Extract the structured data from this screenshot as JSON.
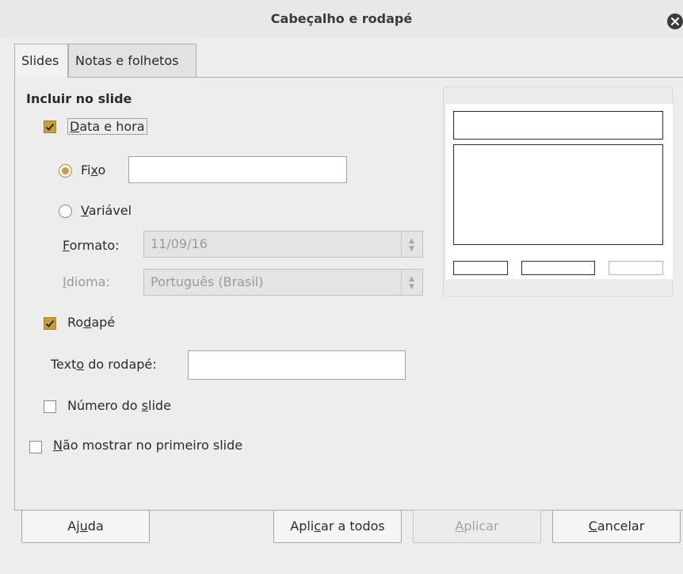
{
  "window": {
    "title": "Cabeçalho e rodapé"
  },
  "tabs": [
    {
      "label": "Slides"
    },
    {
      "label": "Notas e folhetos"
    }
  ],
  "include_section": {
    "title": "Incluir no slide"
  },
  "date_time": {
    "a": "",
    "u": "D",
    "b": "ata e hora",
    "checked": true
  },
  "fixed": {
    "a": "Fi",
    "u": "x",
    "b": "o",
    "selected": true,
    "value": ""
  },
  "variable": {
    "a": "",
    "u": "V",
    "b": "ariável",
    "selected": false
  },
  "format": {
    "a": "",
    "u": "F",
    "b": "ormato:",
    "value": "11/09/16"
  },
  "language": {
    "a": "",
    "u": "I",
    "b": "dioma:",
    "value": "Português (Brasil)"
  },
  "footer": {
    "a": "Ro",
    "u": "d",
    "b": "apé",
    "checked": true
  },
  "footer_text": {
    "a": "Text",
    "u": "o",
    "b": " do rodapé:",
    "value": ""
  },
  "slide_number": {
    "a": "Número do ",
    "u": "s",
    "b": "lide",
    "checked": false
  },
  "hide_first": {
    "a": "",
    "u": "N",
    "b": "ão mostrar no primeiro slide",
    "checked": false
  },
  "buttons": {
    "help": {
      "a": "Aj",
      "u": "u",
      "b": "da"
    },
    "apply_all": {
      "a": "Apli",
      "u": "c",
      "b": "ar a todos"
    },
    "apply": {
      "a": "",
      "u": "A",
      "b": "plicar"
    },
    "cancel": {
      "a": "",
      "u": "C",
      "b": "ancelar"
    }
  },
  "colors": {
    "accent": "#c89f37",
    "window_bg": "#ededed"
  },
  "icons": {
    "close": "close-icon",
    "check": "checkmark-icon",
    "spin": "spin-arrows-icon"
  }
}
